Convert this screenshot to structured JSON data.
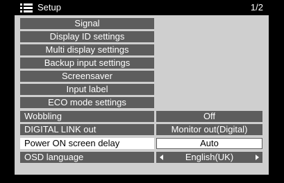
{
  "header": {
    "title": "Setup",
    "page": "1/2",
    "icon": "menu-list-icon"
  },
  "submenus": [
    "Signal",
    "Display ID settings",
    "Multi display settings",
    "Backup input settings",
    "Screensaver",
    "Input label",
    "ECO mode settings"
  ],
  "settings": [
    {
      "label": "Wobbling",
      "value": "Off"
    },
    {
      "label": "DIGITAL LINK out",
      "value": "Monitor out(Digital)"
    },
    {
      "label": "Power ON screen delay",
      "value": "Auto",
      "selected": true
    },
    {
      "label": "OSD language",
      "value": "English(UK)"
    }
  ],
  "colors": {
    "panel": "#cfcfcf",
    "row": "#5d5d5d",
    "selected": "#ffffff",
    "text": "#ffffff"
  }
}
